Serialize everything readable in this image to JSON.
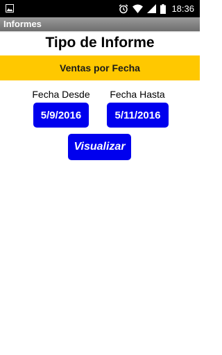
{
  "status_bar": {
    "time": "18:36",
    "icons": [
      "image-icon",
      "alarm-icon",
      "wifi-icon",
      "signal-icon",
      "battery-icon"
    ]
  },
  "app_bar": {
    "title": "Informes"
  },
  "main": {
    "heading": "Tipo de Informe",
    "report_type": "Ventas por Fecha",
    "date_from": {
      "label": "Fecha Desde",
      "value": "5/9/2016"
    },
    "date_to": {
      "label": "Fecha Hasta",
      "value": "5/11/2016"
    },
    "view_button_label": "Visualizar"
  },
  "colors": {
    "status_bar_bg": "#000000",
    "title_bar_bg": "#8a8a8a",
    "accent_yellow": "#ffc800",
    "button_blue": "#0000ee"
  }
}
